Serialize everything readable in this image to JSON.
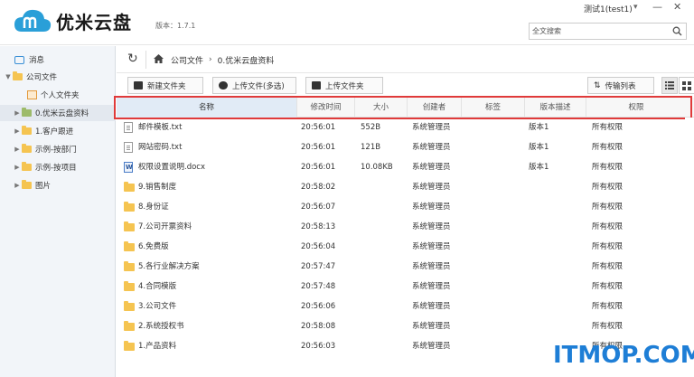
{
  "app": {
    "name": "优米云盘",
    "version": "版本：1.7.1",
    "user": "测试1(test1)",
    "search_placeholder": "全文搜索"
  },
  "sidebar": {
    "items": [
      {
        "label": "消息",
        "indent": 0,
        "icon": "message-icon",
        "arrow": ""
      },
      {
        "label": "公司文件",
        "indent": 0,
        "icon": "folder-icon",
        "arrow": "▼"
      },
      {
        "label": "个人文件夹",
        "indent": 1,
        "icon": "user-folder-icon",
        "arrow": ""
      },
      {
        "label": "0.优米云盘资料",
        "indent": 1,
        "icon": "folder-icon",
        "arrow": "▶",
        "active": true
      },
      {
        "label": "1.客户跟进",
        "indent": 1,
        "icon": "folder-icon",
        "arrow": "▶"
      },
      {
        "label": "示例-按部门",
        "indent": 1,
        "icon": "folder-icon",
        "arrow": "▶"
      },
      {
        "label": "示例-按项目",
        "indent": 1,
        "icon": "folder-icon",
        "arrow": "▶"
      },
      {
        "label": "图片",
        "indent": 1,
        "icon": "folder-icon",
        "arrow": "▶"
      }
    ]
  },
  "breadcrumb": [
    "公司文件",
    "0.优米云盘资料"
  ],
  "toolbar": {
    "new_folder": "新建文件夹",
    "upload_files": "上传文件(多选)",
    "upload_folder": "上传文件夹",
    "transfer_list": "传输列表"
  },
  "columns": [
    "名称",
    "修改时间",
    "大小",
    "创建者",
    "标签",
    "版本描述",
    "权限"
  ],
  "files": [
    {
      "name": "邮件模板.txt",
      "type": "txt",
      "time": "20:56:01",
      "size": "552B",
      "creator": "系统管理员",
      "version": "版本1",
      "perm": "所有权限"
    },
    {
      "name": "网站密码.txt",
      "type": "txt",
      "time": "20:56:01",
      "size": "121B",
      "creator": "系统管理员",
      "version": "版本1",
      "perm": "所有权限"
    },
    {
      "name": "权限设置说明.docx",
      "type": "docx",
      "time": "20:56:01",
      "size": "10.08KB",
      "creator": "系统管理员",
      "version": "版本1",
      "perm": "所有权限"
    },
    {
      "name": "9.销售制度",
      "type": "folder",
      "time": "20:58:02",
      "size": "",
      "creator": "系统管理员",
      "version": "",
      "perm": "所有权限"
    },
    {
      "name": "8.身份证",
      "type": "folder",
      "time": "20:56:07",
      "size": "",
      "creator": "系统管理员",
      "version": "",
      "perm": "所有权限"
    },
    {
      "name": "7.公司开票资料",
      "type": "folder",
      "time": "20:58:13",
      "size": "",
      "creator": "系统管理员",
      "version": "",
      "perm": "所有权限"
    },
    {
      "name": "6.免费版",
      "type": "folder",
      "time": "20:56:04",
      "size": "",
      "creator": "系统管理员",
      "version": "",
      "perm": "所有权限"
    },
    {
      "name": "5.各行业解决方案",
      "type": "folder",
      "time": "20:57:47",
      "size": "",
      "creator": "系统管理员",
      "version": "",
      "perm": "所有权限"
    },
    {
      "name": "4.合同模版",
      "type": "folder",
      "time": "20:57:48",
      "size": "",
      "creator": "系统管理员",
      "version": "",
      "perm": "所有权限"
    },
    {
      "name": "3.公司文件",
      "type": "folder",
      "time": "20:56:06",
      "size": "",
      "creator": "系统管理员",
      "version": "",
      "perm": "所有权限"
    },
    {
      "name": "2.系统授权书",
      "type": "folder",
      "time": "20:58:08",
      "size": "",
      "creator": "系统管理员",
      "version": "",
      "perm": "所有权限"
    },
    {
      "name": "1.产品资料",
      "type": "folder",
      "time": "20:56:03",
      "size": "",
      "creator": "系统管理员",
      "version": "",
      "perm": "所有权限"
    }
  ],
  "watermark": "ITMOP.COM",
  "colors": {
    "accent": "#1e7ed6",
    "highlight": "#e03a3a",
    "folder": "#f5c451",
    "logo": "#2a9fd8"
  }
}
